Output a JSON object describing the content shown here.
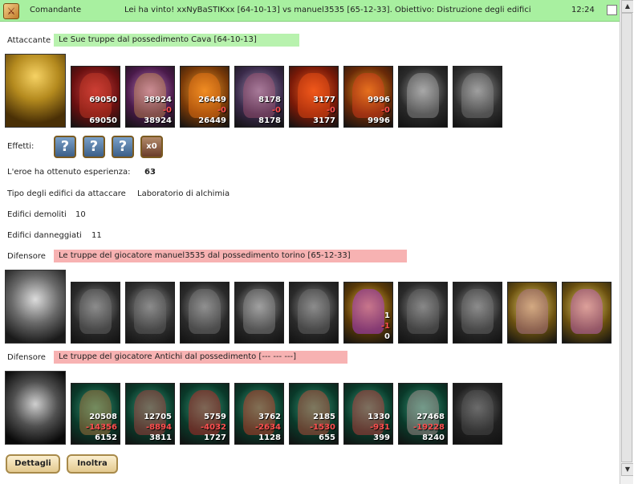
{
  "header": {
    "category": "Comandante",
    "subject": "Lei ha vinto! xxNyBaSTIKxx [64-10-13] vs manuel3535 [65-12-33]. Obiettivo: Distruzione degli edifici",
    "time": "12:24"
  },
  "attacker": {
    "label": "Attaccante",
    "description": "Le Sue truppe dal possedimento Cava [64-10-13]",
    "units": [
      {
        "top": "69050",
        "mid": "",
        "bottom": "69050"
      },
      {
        "top": "38924",
        "mid": "-0",
        "bottom": "38924"
      },
      {
        "top": "26449",
        "mid": "-0",
        "bottom": "26449"
      },
      {
        "top": "8178",
        "mid": "-0",
        "bottom": "8178"
      },
      {
        "top": "3177",
        "mid": "-0",
        "bottom": "3177"
      },
      {
        "top": "9996",
        "mid": "-0",
        "bottom": "9996"
      },
      {
        "top": "",
        "mid": "",
        "bottom": ""
      },
      {
        "top": "",
        "mid": "",
        "bottom": ""
      }
    ]
  },
  "effects": {
    "label": "Effetti:",
    "items": [
      {
        "icon": "question-icon",
        "text": "?"
      },
      {
        "icon": "question-icon",
        "text": "?"
      },
      {
        "icon": "question-icon",
        "text": "?"
      },
      {
        "icon": "spell-icon",
        "text": "x0"
      }
    ]
  },
  "stats": {
    "experience_label": "L'eroe ha ottenuto esperienza:",
    "experience_value": "63",
    "building_type_label": "Tipo degli edifici da attaccare",
    "building_type_value": "Laboratorio di alchimia",
    "demolished_label": "Edifici demoliti",
    "demolished_value": "10",
    "damaged_label": "Edifici danneggiati",
    "damaged_value": "11"
  },
  "defender1": {
    "label": "Difensore",
    "description": "Le truppe del giocatore manuel3535 dal possedimento torino [65-12-33]",
    "units": [
      {
        "top": "",
        "mid": "",
        "bottom": ""
      },
      {
        "top": "",
        "mid": "",
        "bottom": ""
      },
      {
        "top": "",
        "mid": "",
        "bottom": ""
      },
      {
        "top": "",
        "mid": "",
        "bottom": ""
      },
      {
        "top": "",
        "mid": "",
        "bottom": ""
      },
      {
        "top": "1",
        "mid": "-1",
        "bottom": "0"
      },
      {
        "top": "",
        "mid": "",
        "bottom": ""
      },
      {
        "top": "",
        "mid": "",
        "bottom": ""
      },
      {
        "top": "",
        "mid": "",
        "bottom": ""
      },
      {
        "top": "",
        "mid": "",
        "bottom": ""
      }
    ]
  },
  "defender2": {
    "label": "Difensore",
    "description": "Le truppe del giocatore Antichi dal possedimento [--- --- ---]",
    "units": [
      {
        "top": "20508",
        "mid": "-14356",
        "bottom": "6152"
      },
      {
        "top": "12705",
        "mid": "-8894",
        "bottom": "3811"
      },
      {
        "top": "5759",
        "mid": "-4032",
        "bottom": "1727"
      },
      {
        "top": "3762",
        "mid": "-2634",
        "bottom": "1128"
      },
      {
        "top": "2185",
        "mid": "-1530",
        "bottom": "655"
      },
      {
        "top": "1330",
        "mid": "-931",
        "bottom": "399"
      },
      {
        "top": "27468",
        "mid": "-19228",
        "bottom": "8240"
      },
      {
        "top": "",
        "mid": "",
        "bottom": ""
      }
    ]
  },
  "buttons": {
    "details": "Dettagli",
    "forward": "Inoltra"
  },
  "colors": {
    "header_bg": "#a8f0a0",
    "attacker_bg": "#b8f2ae",
    "defender_bg": "#f7b2b2",
    "loss": "#ff5050"
  }
}
